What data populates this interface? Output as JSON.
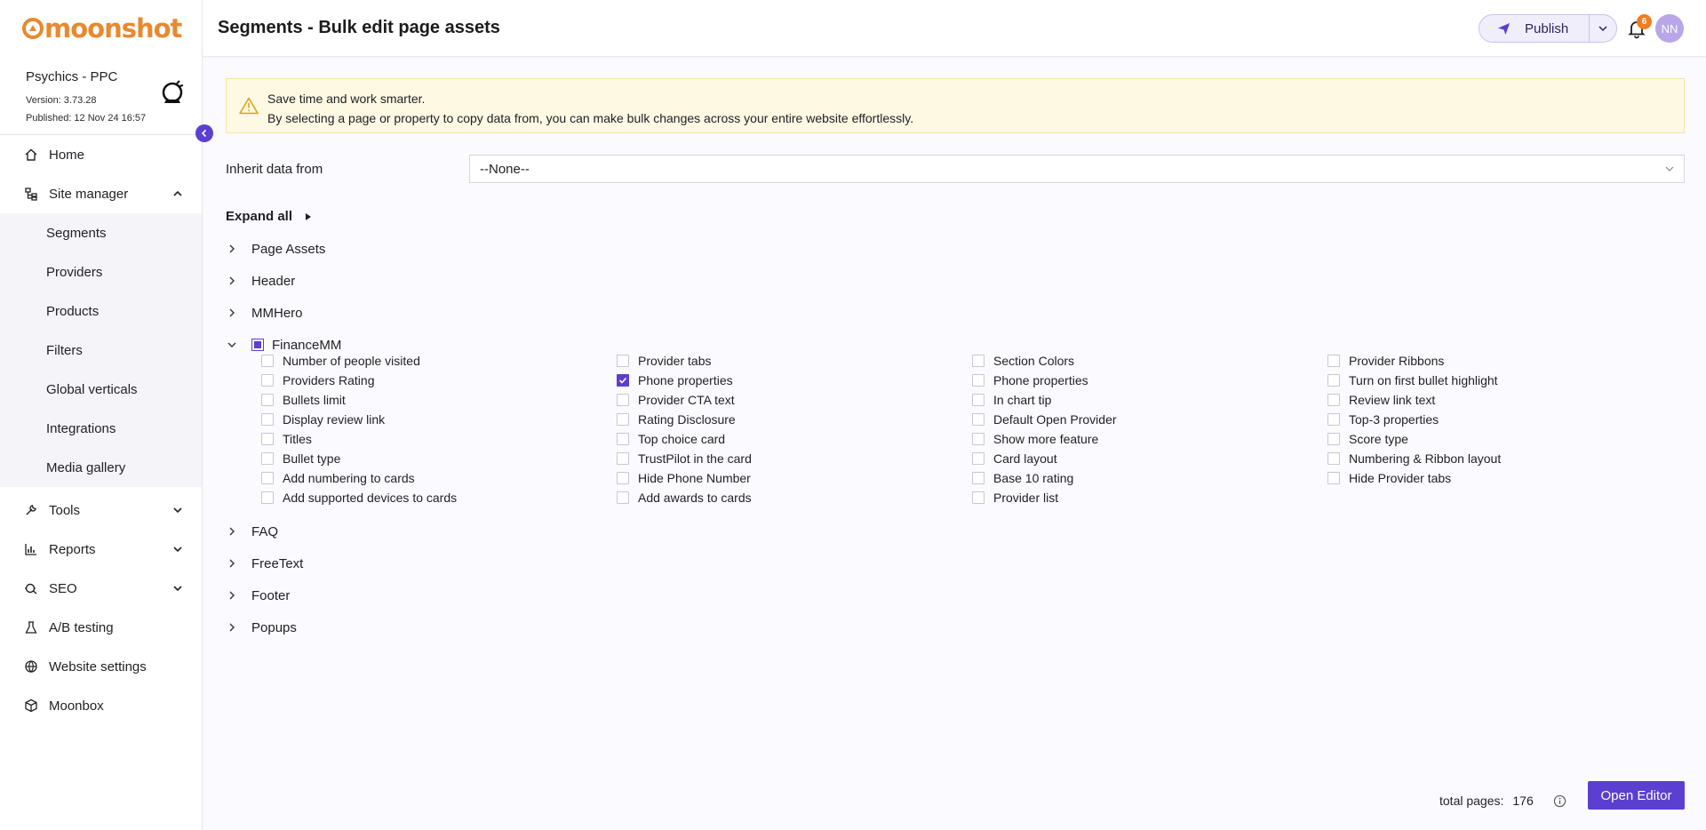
{
  "brand": {
    "name": "moonshot",
    "accent": "#e8892f",
    "primary": "#5b3fd1"
  },
  "site": {
    "name": "Psychics - PPC",
    "version": "Version: 3.73.28",
    "published": "Published: 12 Nov 24 16:57",
    "avatar_icon": "crystal-ball-icon"
  },
  "sidebar": {
    "items": [
      {
        "label": "Home",
        "icon": "home-icon"
      },
      {
        "label": "Site manager",
        "icon": "sitemap-icon",
        "expanded": true,
        "children": [
          "Segments",
          "Providers",
          "Products",
          "Filters",
          "Global verticals",
          "Integrations",
          "Media gallery"
        ]
      },
      {
        "label": "Tools",
        "icon": "wrench-icon"
      },
      {
        "label": "Reports",
        "icon": "chart-icon"
      },
      {
        "label": "SEO",
        "icon": "seo-icon"
      },
      {
        "label": "A/B testing",
        "icon": "flask-icon"
      },
      {
        "label": "Website settings",
        "icon": "globe-icon"
      },
      {
        "label": "Moonbox",
        "icon": "box-icon"
      }
    ]
  },
  "header": {
    "title": "Segments - Bulk edit page assets",
    "publish_label": "Publish",
    "notification_count": "6",
    "user_initials": "NN"
  },
  "alert": {
    "line1": "Save time and work smarter.",
    "line2": "By selecting a page or property to copy data from, you can make bulk changes across your entire website effortlessly."
  },
  "inherit": {
    "label": "Inherit data from",
    "value": "--None--"
  },
  "expand_all_label": "Expand all",
  "sections_before": [
    "Page Assets",
    "Header",
    "MMHero"
  ],
  "finance": {
    "label": "FinanceMM",
    "columns": [
      [
        {
          "label": "Number of people visited",
          "checked": false
        },
        {
          "label": "Providers Rating",
          "checked": false
        },
        {
          "label": "Bullets limit",
          "checked": false
        },
        {
          "label": "Display review link",
          "checked": false
        },
        {
          "label": "Titles",
          "checked": false
        },
        {
          "label": "Bullet type",
          "checked": false
        },
        {
          "label": "Add numbering to cards",
          "checked": false
        },
        {
          "label": "Add supported devices to cards",
          "checked": false
        }
      ],
      [
        {
          "label": "Provider tabs",
          "checked": false
        },
        {
          "label": "Phone properties",
          "checked": true
        },
        {
          "label": "Provider CTA text",
          "checked": false
        },
        {
          "label": "Rating Disclosure",
          "checked": false
        },
        {
          "label": "Top choice card",
          "checked": false
        },
        {
          "label": "TrustPilot in the card",
          "checked": false
        },
        {
          "label": "Hide Phone Number",
          "checked": false
        },
        {
          "label": "Add awards to cards",
          "checked": false
        }
      ],
      [
        {
          "label": "Section Colors",
          "checked": false
        },
        {
          "label": "Phone properties",
          "checked": false
        },
        {
          "label": "In chart tip",
          "checked": false
        },
        {
          "label": "Default Open Provider",
          "checked": false
        },
        {
          "label": "Show more feature",
          "checked": false
        },
        {
          "label": "Card layout",
          "checked": false
        },
        {
          "label": "Base 10 rating",
          "checked": false
        },
        {
          "label": "Provider list",
          "checked": false
        }
      ],
      [
        {
          "label": "Provider Ribbons",
          "checked": false
        },
        {
          "label": "Turn on first bullet highlight",
          "checked": false
        },
        {
          "label": "Review link text",
          "checked": false
        },
        {
          "label": "Top-3 properties",
          "checked": false
        },
        {
          "label": "Score type",
          "checked": false
        },
        {
          "label": "Numbering & Ribbon layout",
          "checked": false
        },
        {
          "label": "Hide Provider tabs",
          "checked": false
        }
      ]
    ]
  },
  "sections_after": [
    "FAQ",
    "FreeText",
    "Footer",
    "Popups"
  ],
  "footer": {
    "total_label": "total pages:",
    "total_value": "176",
    "open_editor_label": "Open Editor"
  }
}
